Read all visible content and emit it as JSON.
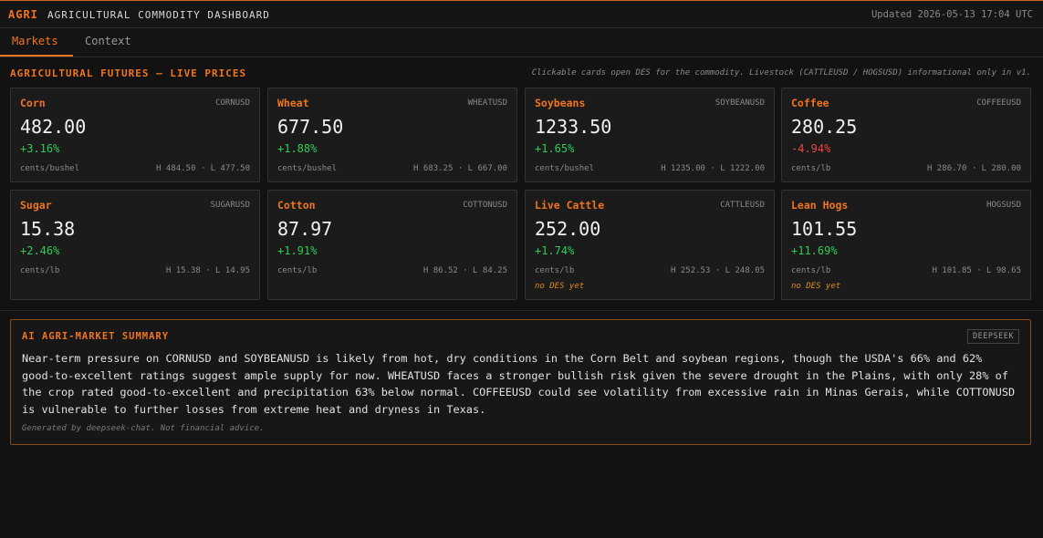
{
  "header": {
    "brand": "AGRI",
    "title": "AGRICULTURAL COMMODITY DASHBOARD",
    "updated": "Updated 2026-05-13 17:04 UTC"
  },
  "tabs": [
    {
      "label": "Markets",
      "active": true
    },
    {
      "label": "Context",
      "active": false
    }
  ],
  "section": {
    "title": "AGRICULTURAL FUTURES — LIVE PRICES",
    "note": "Clickable cards open DES for the commodity. Livestock (CATTLEUSD / HOGSUSD) informational only in v1."
  },
  "cards": [
    {
      "name": "Corn",
      "ticker": "CORNUSD",
      "price": "482.00",
      "change": "+3.16%",
      "direction": "up",
      "unit": "cents/bushel",
      "hl": "H 484.50 · L 477.50",
      "note": ""
    },
    {
      "name": "Wheat",
      "ticker": "WHEATUSD",
      "price": "677.50",
      "change": "+1.88%",
      "direction": "up",
      "unit": "cents/bushel",
      "hl": "H 683.25 · L 667.00",
      "note": ""
    },
    {
      "name": "Soybeans",
      "ticker": "SOYBEANUSD",
      "price": "1233.50",
      "change": "+1.65%",
      "direction": "up",
      "unit": "cents/bushel",
      "hl": "H 1235.00 · L 1222.00",
      "note": ""
    },
    {
      "name": "Coffee",
      "ticker": "COFFEEUSD",
      "price": "280.25",
      "change": "-4.94%",
      "direction": "down",
      "unit": "cents/lb",
      "hl": "H 286.70 · L 280.00",
      "note": ""
    },
    {
      "name": "Sugar",
      "ticker": "SUGARUSD",
      "price": "15.38",
      "change": "+2.46%",
      "direction": "up",
      "unit": "cents/lb",
      "hl": "H 15.38 · L 14.95",
      "note": ""
    },
    {
      "name": "Cotton",
      "ticker": "COTTONUSD",
      "price": "87.97",
      "change": "+1.91%",
      "direction": "up",
      "unit": "cents/lb",
      "hl": "H 86.52 · L 84.25",
      "note": ""
    },
    {
      "name": "Live Cattle",
      "ticker": "CATTLEUSD",
      "price": "252.00",
      "change": "+1.74%",
      "direction": "up",
      "unit": "cents/lb",
      "hl": "H 252.53 · L 248.05",
      "note": "no DES yet"
    },
    {
      "name": "Lean Hogs",
      "ticker": "HOGSUSD",
      "price": "101.55",
      "change": "+11.69%",
      "direction": "up",
      "unit": "cents/lb",
      "hl": "H 101.85 · L 98.65",
      "note": "no DES yet"
    }
  ],
  "summary": {
    "title": "AI AGRI-MARKET SUMMARY",
    "badge": "DEEPSEEK",
    "body": "Near-term pressure on CORNUSD and SOYBEANUSD is likely from hot, dry conditions in the Corn Belt and soybean regions, though the USDA's 66% and 62% good-to-excellent ratings suggest ample supply for now. WHEATUSD faces a stronger bullish risk given the severe drought in the Plains, with only 28% of the crop rated good-to-excellent and precipitation 63% below normal. COFFEEUSD could see volatility from excessive rain in Minas Gerais, while COTTONUSD is vulnerable to further losses from extreme heat and dryness in Texas.",
    "footer": "Generated by deepseek-chat. Not financial advice."
  },
  "colors": {
    "accent": "#f07420",
    "up": "#2ecc55",
    "down": "#ef4444",
    "warning": "#e08a1e"
  }
}
